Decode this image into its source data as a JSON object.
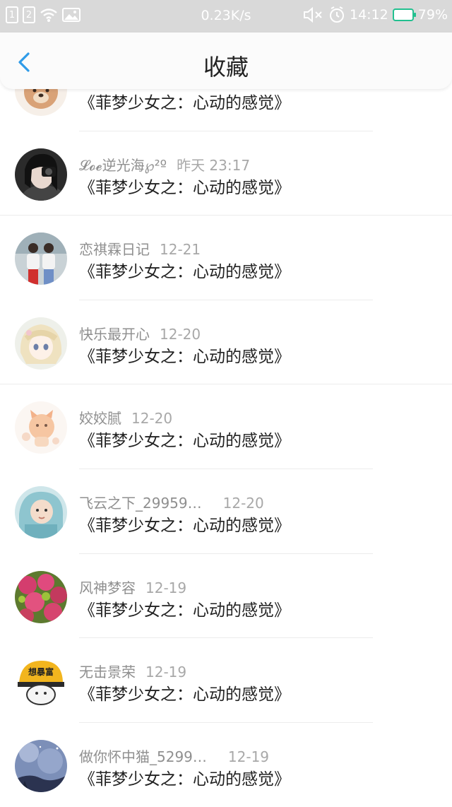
{
  "status_bar": {
    "sim1": "1",
    "sim2": "2",
    "network_speed": "0.23K/s",
    "time": "14:12",
    "battery": "79%"
  },
  "header": {
    "title": "收藏"
  },
  "items": [
    {
      "name": "",
      "time": "",
      "title": "《菲梦少女之：心动的感觉》",
      "avatar": "bear-avatar"
    },
    {
      "name": "𝓛𝓸𝓮逆光海℘²º",
      "time": "昨天 23:17",
      "title": "《菲梦少女之：心动的感觉》",
      "avatar": "girl-camera-avatar"
    },
    {
      "name": "恋祺霖日记",
      "time": "12-21",
      "title": "《菲梦少女之：心动的感觉》",
      "avatar": "couple-avatar"
    },
    {
      "name": "快乐最开心",
      "time": "12-20",
      "title": "《菲梦少女之：心动的感觉》",
      "avatar": "anime-girl-avatar"
    },
    {
      "name": "姣姣腻",
      "time": "12-20",
      "title": "《菲梦少女之：心动的感觉》",
      "avatar": "cat-drawing-avatar"
    },
    {
      "name": "飞云之下_29959…",
      "time": "12-20",
      "title": "《菲梦少女之：心动的感觉》",
      "avatar": "baby-avatar"
    },
    {
      "name": "风神梦容",
      "time": "12-19",
      "title": "《菲梦少女之：心动的感觉》",
      "avatar": "rambutan-avatar"
    },
    {
      "name": "无击景荣",
      "time": "12-19",
      "title": "《菲梦少女之：心动的感觉》",
      "avatar": "helmet-cartoon-avatar",
      "avatar_text": "想暴富"
    },
    {
      "name": "做你怀中猫_5299…",
      "time": "12-19",
      "title": "《菲梦少女之：心动的感觉》",
      "avatar": "night-sky-avatar"
    }
  ],
  "colors": {
    "status_bar_bg": "#d9d9d9",
    "accent_blue": "#2f9be8",
    "battery_green": "#22c08f"
  }
}
